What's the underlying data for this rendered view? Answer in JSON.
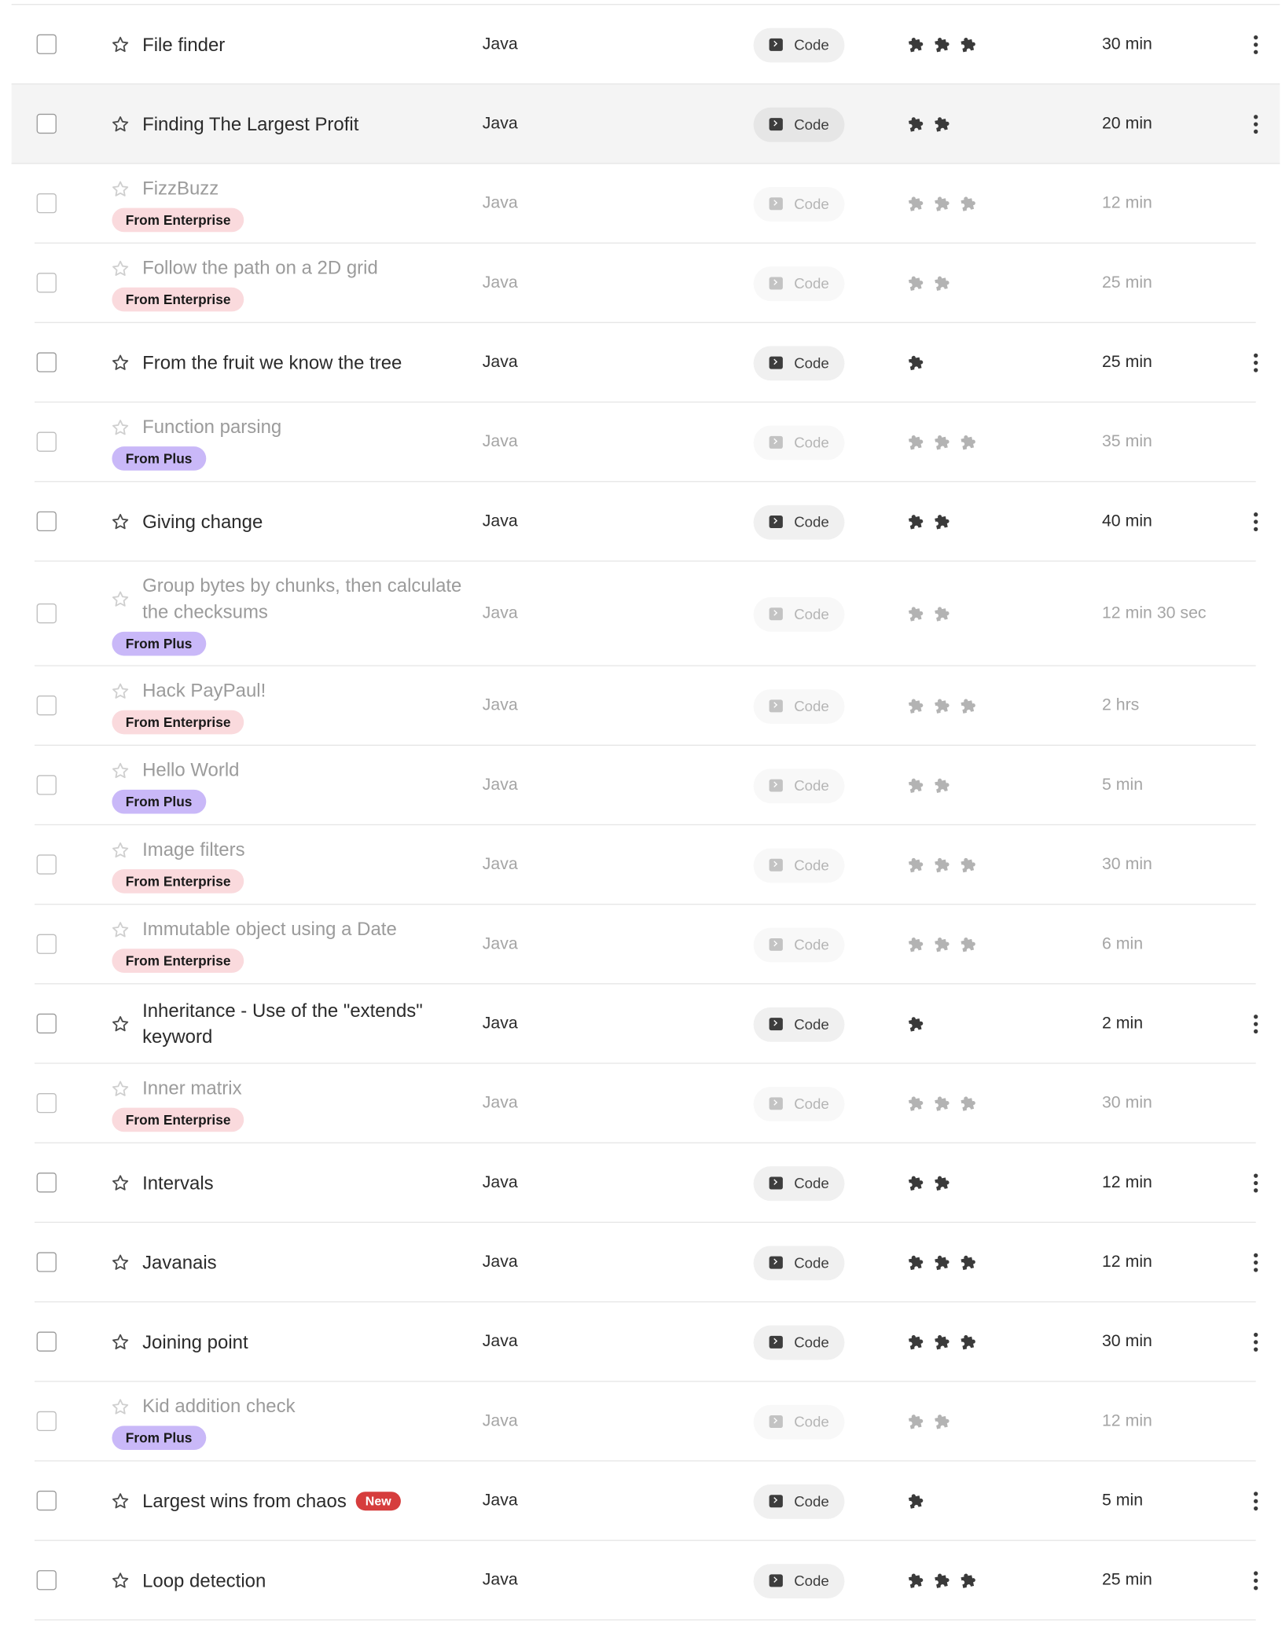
{
  "colors": {
    "enterprise_badge": "#fadadd",
    "plus_badge": "#c9b8f8",
    "new_badge": "#d63d3d",
    "hover_row": "#f4f4f4"
  },
  "rows": [
    {
      "title": "File finder",
      "badge": "",
      "new": "",
      "language": "Java",
      "type": "Code",
      "difficulty": 3,
      "duration": "30 min",
      "locked": false,
      "menu": true
    },
    {
      "title": "Finding The Largest Profit",
      "badge": "",
      "new": "",
      "language": "Java",
      "type": "Code",
      "difficulty": 2,
      "duration": "20 min",
      "locked": false,
      "menu": true,
      "hover": true
    },
    {
      "title": "FizzBuzz",
      "badge": "From Enterprise",
      "new": "",
      "language": "Java",
      "type": "Code",
      "difficulty": 3,
      "duration": "12 min",
      "locked": true,
      "menu": false
    },
    {
      "title": "Follow the path on a 2D grid",
      "badge": "From Enterprise",
      "new": "",
      "language": "Java",
      "type": "Code",
      "difficulty": 2,
      "duration": "25 min",
      "locked": true,
      "menu": false
    },
    {
      "title": "From the fruit we know the tree",
      "badge": "",
      "new": "",
      "language": "Java",
      "type": "Code",
      "difficulty": 1,
      "duration": "25 min",
      "locked": false,
      "menu": true
    },
    {
      "title": "Function parsing",
      "badge": "From Plus",
      "new": "",
      "language": "Java",
      "type": "Code",
      "difficulty": 3,
      "duration": "35 min",
      "locked": true,
      "menu": false
    },
    {
      "title": "Giving change",
      "badge": "",
      "new": "",
      "language": "Java",
      "type": "Code",
      "difficulty": 2,
      "duration": "40 min",
      "locked": false,
      "menu": true
    },
    {
      "title": "Group bytes by chunks, then calculate the checksums",
      "badge": "From Plus",
      "new": "",
      "language": "Java",
      "type": "Code",
      "difficulty": 2,
      "duration": "12 min 30 sec",
      "locked": true,
      "menu": false,
      "tall": true
    },
    {
      "title": "Hack PayPaul!",
      "badge": "From Enterprise",
      "new": "",
      "language": "Java",
      "type": "Code",
      "difficulty": 3,
      "duration": "2 hrs",
      "locked": true,
      "menu": false
    },
    {
      "title": "Hello World",
      "badge": "From Plus",
      "new": "",
      "language": "Java",
      "type": "Code",
      "difficulty": 2,
      "duration": "5 min",
      "locked": true,
      "menu": false
    },
    {
      "title": "Image filters",
      "badge": "From Enterprise",
      "new": "",
      "language": "Java",
      "type": "Code",
      "difficulty": 3,
      "duration": "30 min",
      "locked": true,
      "menu": false
    },
    {
      "title": "Immutable object using a Date",
      "badge": "From Enterprise",
      "new": "",
      "language": "Java",
      "type": "Code",
      "difficulty": 3,
      "duration": "6 min",
      "locked": true,
      "menu": false
    },
    {
      "title": "Inheritance - Use of the \"extends\" keyword",
      "badge": "",
      "new": "",
      "language": "Java",
      "type": "Code",
      "difficulty": 1,
      "duration": "2 min",
      "locked": false,
      "menu": true
    },
    {
      "title": "Inner matrix",
      "badge": "From Enterprise",
      "new": "",
      "language": "Java",
      "type": "Code",
      "difficulty": 3,
      "duration": "30 min",
      "locked": true,
      "menu": false
    },
    {
      "title": "Intervals",
      "badge": "",
      "new": "",
      "language": "Java",
      "type": "Code",
      "difficulty": 2,
      "duration": "12 min",
      "locked": false,
      "menu": true
    },
    {
      "title": "Javanais",
      "badge": "",
      "new": "",
      "language": "Java",
      "type": "Code",
      "difficulty": 3,
      "duration": "12 min",
      "locked": false,
      "menu": true
    },
    {
      "title": "Joining point",
      "badge": "",
      "new": "",
      "language": "Java",
      "type": "Code",
      "difficulty": 3,
      "duration": "30 min",
      "locked": false,
      "menu": true
    },
    {
      "title": "Kid addition check",
      "badge": "From Plus",
      "new": "",
      "language": "Java",
      "type": "Code",
      "difficulty": 2,
      "duration": "12 min",
      "locked": true,
      "menu": false
    },
    {
      "title": "Largest wins from chaos",
      "badge": "",
      "new": "New",
      "language": "Java",
      "type": "Code",
      "difficulty": 1,
      "duration": "5 min",
      "locked": false,
      "menu": true
    },
    {
      "title": "Loop detection",
      "badge": "",
      "new": "",
      "language": "Java",
      "type": "Code",
      "difficulty": 3,
      "duration": "25 min",
      "locked": false,
      "menu": true
    }
  ]
}
